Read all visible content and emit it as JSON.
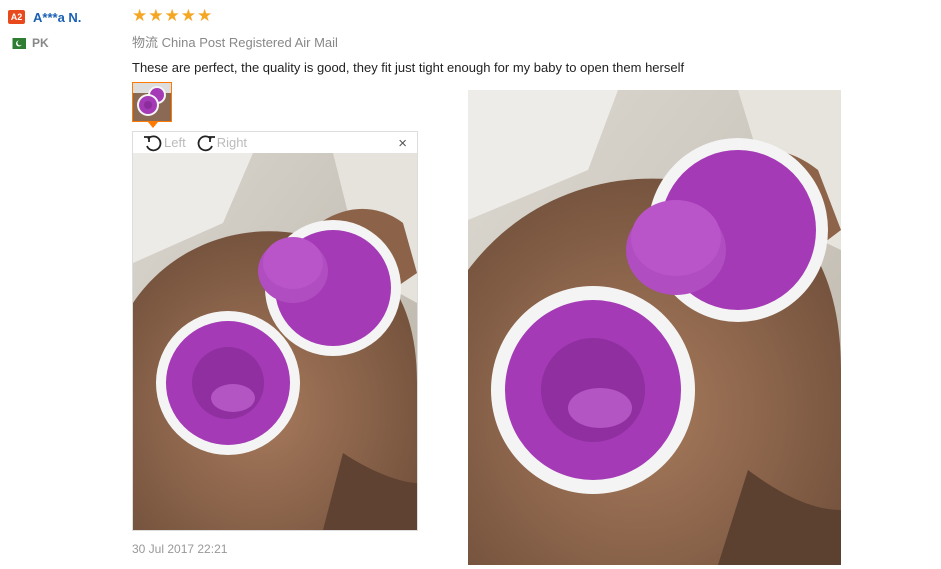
{
  "reviewer": {
    "level_badge": "A2",
    "name": "A***a N.",
    "country": "PK"
  },
  "review": {
    "rating": 5,
    "stars": [
      "★",
      "★",
      "★",
      "★",
      "★"
    ],
    "shipping_label": "物流",
    "shipping_method": "China Post Registered Air Mail",
    "text": "These are perfect, the quality is good, they fit just tight enough for my baby to open them herself",
    "date": "30 Jul 2017 22:21"
  },
  "viewer": {
    "rotate_left_label": "Left",
    "rotate_right_label": "Right",
    "close_symbol": "×"
  },
  "colors": {
    "accent": "#ff7a00",
    "star": "#f5a623",
    "name": "#1a5fb4",
    "badge": "#e8491d",
    "product_purple": "#a43ab5"
  }
}
